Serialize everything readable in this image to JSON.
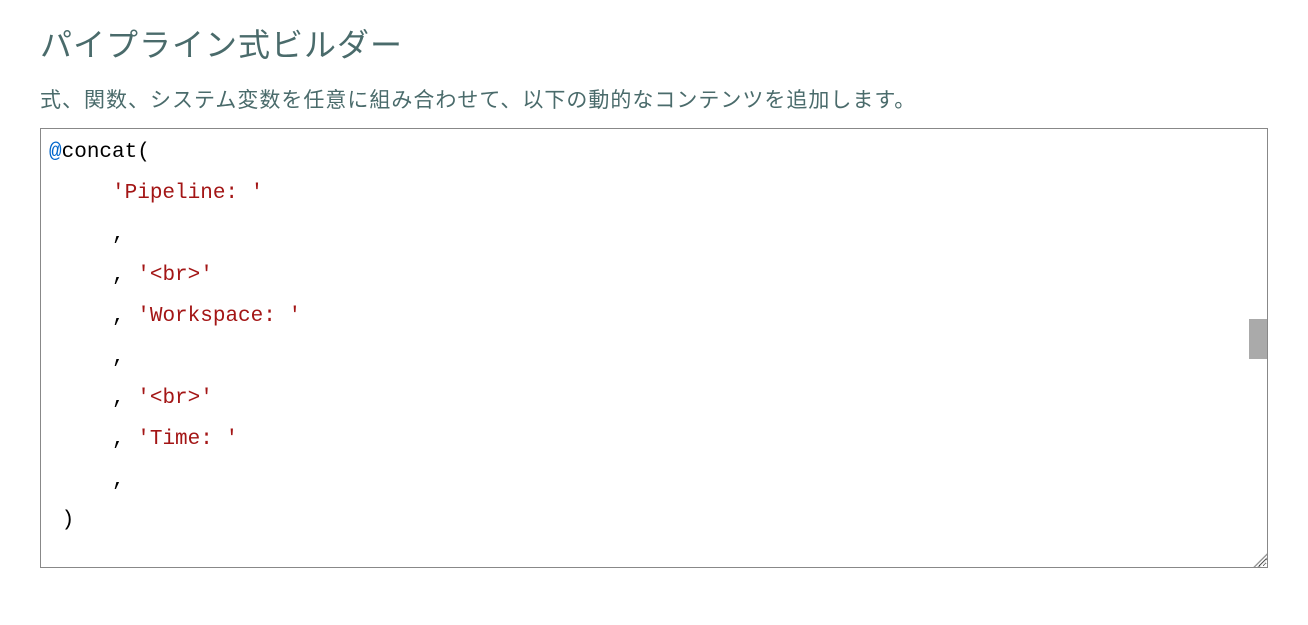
{
  "header": {
    "title": "パイプライン式ビルダー",
    "description": "式、関数、システム変数を任意に組み合わせて、以下の動的なコンテンツを追加します。"
  },
  "editor": {
    "at_symbol": "@",
    "function_name": "concat",
    "open_paren": "(",
    "close_paren": ")",
    "lines": [
      {
        "indent": 1,
        "content": "'Pipeline: '",
        "type": "string"
      },
      {
        "indent": 1,
        "content": ",",
        "type": "comma"
      },
      {
        "indent": 1,
        "content": ", '<br>'",
        "type": "comma_string",
        "comma": ", ",
        "string": "'<br>'"
      },
      {
        "indent": 1,
        "content": ", 'Workspace: '",
        "type": "comma_string",
        "comma": ", ",
        "string": "'Workspace: '"
      },
      {
        "indent": 1,
        "content": ",",
        "type": "comma"
      },
      {
        "indent": 1,
        "content": ", '<br>'",
        "type": "comma_string",
        "comma": ", ",
        "string": "'<br>'"
      },
      {
        "indent": 1,
        "content": ", 'Time: '",
        "type": "comma_string",
        "comma": ", ",
        "string": "'Time: '"
      },
      {
        "indent": 1,
        "content": ",",
        "type": "comma"
      }
    ]
  }
}
